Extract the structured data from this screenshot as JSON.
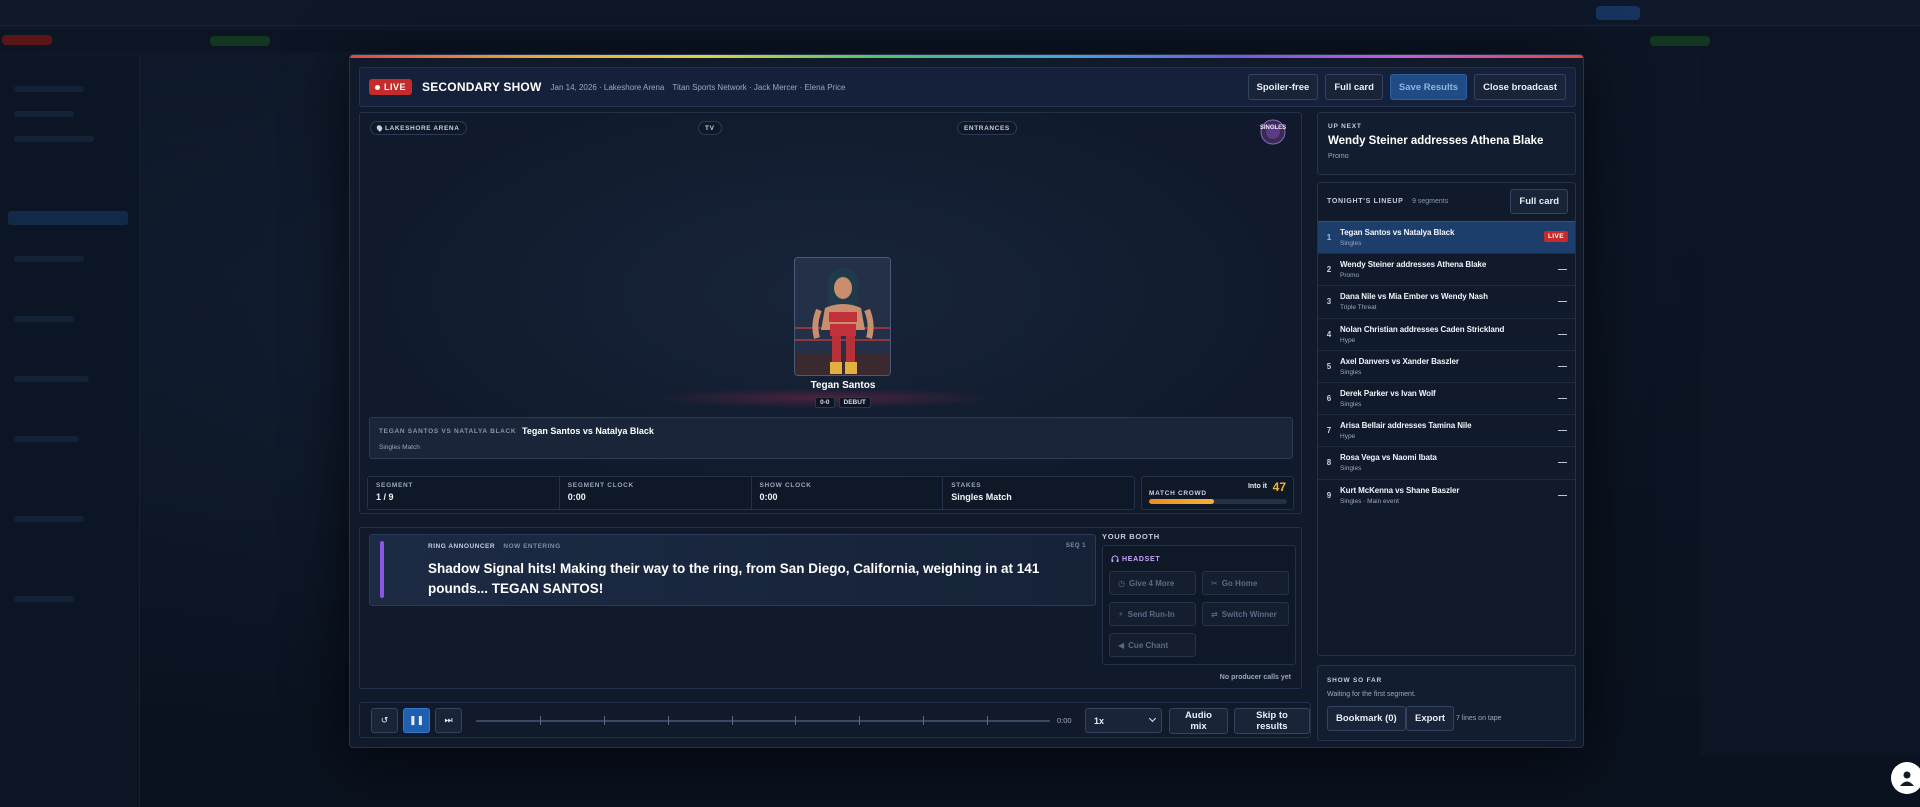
{
  "header": {
    "live_label": "LIVE",
    "show_name": "SECONDARY SHOW",
    "meta": "Jan 14, 2026 · Lakeshore Arena",
    "network": "Titan Sports Network · Jack Mercer · Elena Price",
    "buttons": {
      "spoiler": "Spoiler-free",
      "full_card": "Full card",
      "save_results": "Save Results",
      "close": "Close broadcast"
    }
  },
  "stage": {
    "location_tag": "LAKESHORE ARENA",
    "tv_tag": "TV",
    "entrances_tag": "ENTRANCES",
    "logo_text": "SINGLES",
    "wrestler_name": "Tegan Santos",
    "record": "0-0",
    "debut": "DEBUT",
    "match_kicker": "TEGAN SANTOS VS NATALYA BLACK",
    "match_title": "Tegan Santos vs Natalya Black",
    "match_type": "Singles Match"
  },
  "stats": [
    {
      "label": "SEGMENT",
      "value": "1 / 9"
    },
    {
      "label": "SEGMENT CLOCK",
      "value": "0:00"
    },
    {
      "label": "SHOW CLOCK",
      "value": "0:00"
    },
    {
      "label": "STAKES",
      "value": "Singles Match"
    }
  ],
  "crowd": {
    "label": "MATCH CROWD",
    "mood": "Into it",
    "value": "47",
    "level": 0.47
  },
  "announcer": {
    "role": "RING ANNOUNCER",
    "status": "NOW ENTERING",
    "seq": "SEQ 1",
    "text": "Shadow Signal hits! Making their way to the ring, from San Diego, California, weighing in at 141 pounds... TEGAN SANTOS!"
  },
  "booth": {
    "title": "YOUR BOOTH",
    "headset": "HEADSET",
    "give_more": "Give 4 More",
    "go_home": "Go Home",
    "send_runin": "Send Run-In",
    "switch_winner": "Switch Winner",
    "cue_chant": "Cue Chant",
    "producer_note": "No producer calls yet"
  },
  "transport": {
    "time": "0:00",
    "speed": "1x",
    "audio_mix": "Audio mix",
    "skip": "Skip to results",
    "progress": 0
  },
  "up_next": {
    "kicker": "UP NEXT",
    "title": "Wendy Steiner addresses Athena Blake",
    "type": "Promo"
  },
  "lineup": {
    "title": "TONIGHT'S LINEUP",
    "count": "9 segments",
    "full_card": "Full card",
    "live_label": "LIVE",
    "pending_mark": "—",
    "segments": [
      {
        "num": "1",
        "title": "Tegan Santos vs Natalya Black",
        "type": "Singles"
      },
      {
        "num": "2",
        "title": "Wendy Steiner addresses Athena Blake",
        "type": "Promo"
      },
      {
        "num": "3",
        "title": "Dana Nile vs Mia Ember vs Wendy Nash",
        "type": "Triple Threat"
      },
      {
        "num": "4",
        "title": "Nolan Christian addresses Caden Strickland",
        "type": "Hype"
      },
      {
        "num": "5",
        "title": "Axel Danvers vs Xander Baszler",
        "type": "Singles"
      },
      {
        "num": "6",
        "title": "Derek Parker vs Ivan Wolf",
        "type": "Singles"
      },
      {
        "num": "7",
        "title": "Arisa Bellair addresses Tamina Nile",
        "type": "Hype"
      },
      {
        "num": "8",
        "title": "Rosa Vega vs Naomi Ibata",
        "type": "Singles"
      },
      {
        "num": "9",
        "title": "Kurt McKenna vs Shane Baszler",
        "type": "Singles · Main event"
      }
    ]
  },
  "so_far": {
    "kicker": "SHOW SO FAR",
    "text": "Waiting for the first segment.",
    "bookmark": "Bookmark (0)",
    "export": "Export",
    "tape": "7 lines on tape"
  },
  "colors": {
    "live_red": "#c52b2b",
    "accent_blue": "#1f5fb0",
    "crowd_orange": "#f2b23a",
    "announcer_purple": "#8b55e8"
  }
}
